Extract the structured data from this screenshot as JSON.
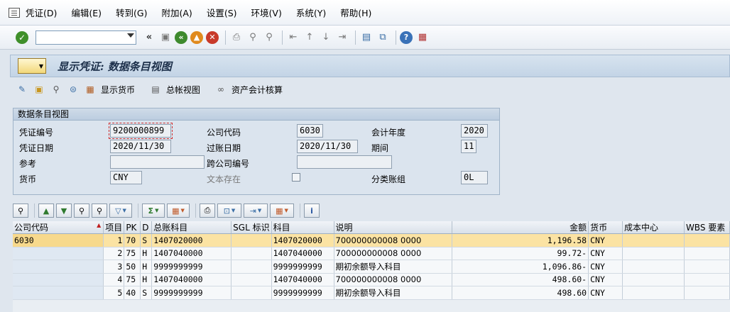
{
  "menubar": {
    "items": [
      "凭证(D)",
      "编辑(E)",
      "转到(G)",
      "附加(A)",
      "设置(S)",
      "环境(V)",
      "系统(Y)",
      "帮助(H)"
    ]
  },
  "toolbar": {
    "command_value": ""
  },
  "title": "显示凭证: 数据条目视图",
  "app_toolbar": {
    "buttons": [
      "显示货币",
      "总帐视图",
      "资产会计核算"
    ]
  },
  "header_panel": {
    "title": "数据条目视图",
    "fields": {
      "doc_no": {
        "label": "凭证编号",
        "value": "9200000899"
      },
      "company_code": {
        "label": "公司代码",
        "value": "6030"
      },
      "fiscal_year": {
        "label": "会计年度",
        "value": "2020"
      },
      "doc_date": {
        "label": "凭证日期",
        "value": "2020/11/30"
      },
      "posting_date": {
        "label": "过账日期",
        "value": "2020/11/30"
      },
      "period": {
        "label": "期间",
        "value": "11"
      },
      "reference": {
        "label": "参考",
        "value": ""
      },
      "cross_company": {
        "label": "跨公司编号",
        "value": ""
      },
      "currency": {
        "label": "货币",
        "value": "CNY"
      },
      "text_exists": {
        "label": "文本存在"
      },
      "ledger_group": {
        "label": "分类账组",
        "value": "0L"
      }
    }
  },
  "grid": {
    "columns": [
      "公司代码",
      "项目",
      "PK",
      "D",
      "总账科目",
      "SGL 标识",
      "科目",
      "说明",
      "金额",
      "货币",
      "成本中心",
      "WBS 要素"
    ],
    "rows": [
      {
        "cc": "6030",
        "item": "1",
        "pk": "70",
        "d": "S",
        "gl": "1407020000",
        "sgl": "",
        "acct": "1407020000",
        "desc": "700000000008 0000",
        "amount": "1,196.58",
        "curr": "CNY",
        "cost": "",
        "wbs": ""
      },
      {
        "cc": "",
        "item": "2",
        "pk": "75",
        "d": "H",
        "gl": "1407040000",
        "sgl": "",
        "acct": "1407040000",
        "desc": "700000000008 0000",
        "amount": "99.72-",
        "curr": "CNY",
        "cost": "",
        "wbs": ""
      },
      {
        "cc": "",
        "item": "3",
        "pk": "50",
        "d": "H",
        "gl": "9999999999",
        "sgl": "",
        "acct": "9999999999",
        "desc": "期初余额导入科目",
        "amount": "1,096.86-",
        "curr": "CNY",
        "cost": "",
        "wbs": ""
      },
      {
        "cc": "",
        "item": "4",
        "pk": "75",
        "d": "H",
        "gl": "1407040000",
        "sgl": "",
        "acct": "1407040000",
        "desc": "700000000008 0000",
        "amount": "498.60-",
        "curr": "CNY",
        "cost": "",
        "wbs": ""
      },
      {
        "cc": "",
        "item": "5",
        "pk": "40",
        "d": "S",
        "gl": "9999999999",
        "sgl": "",
        "acct": "9999999999",
        "desc": "期初余额导入科目",
        "amount": "498.60",
        "curr": "CNY",
        "cost": "",
        "wbs": ""
      }
    ]
  }
}
